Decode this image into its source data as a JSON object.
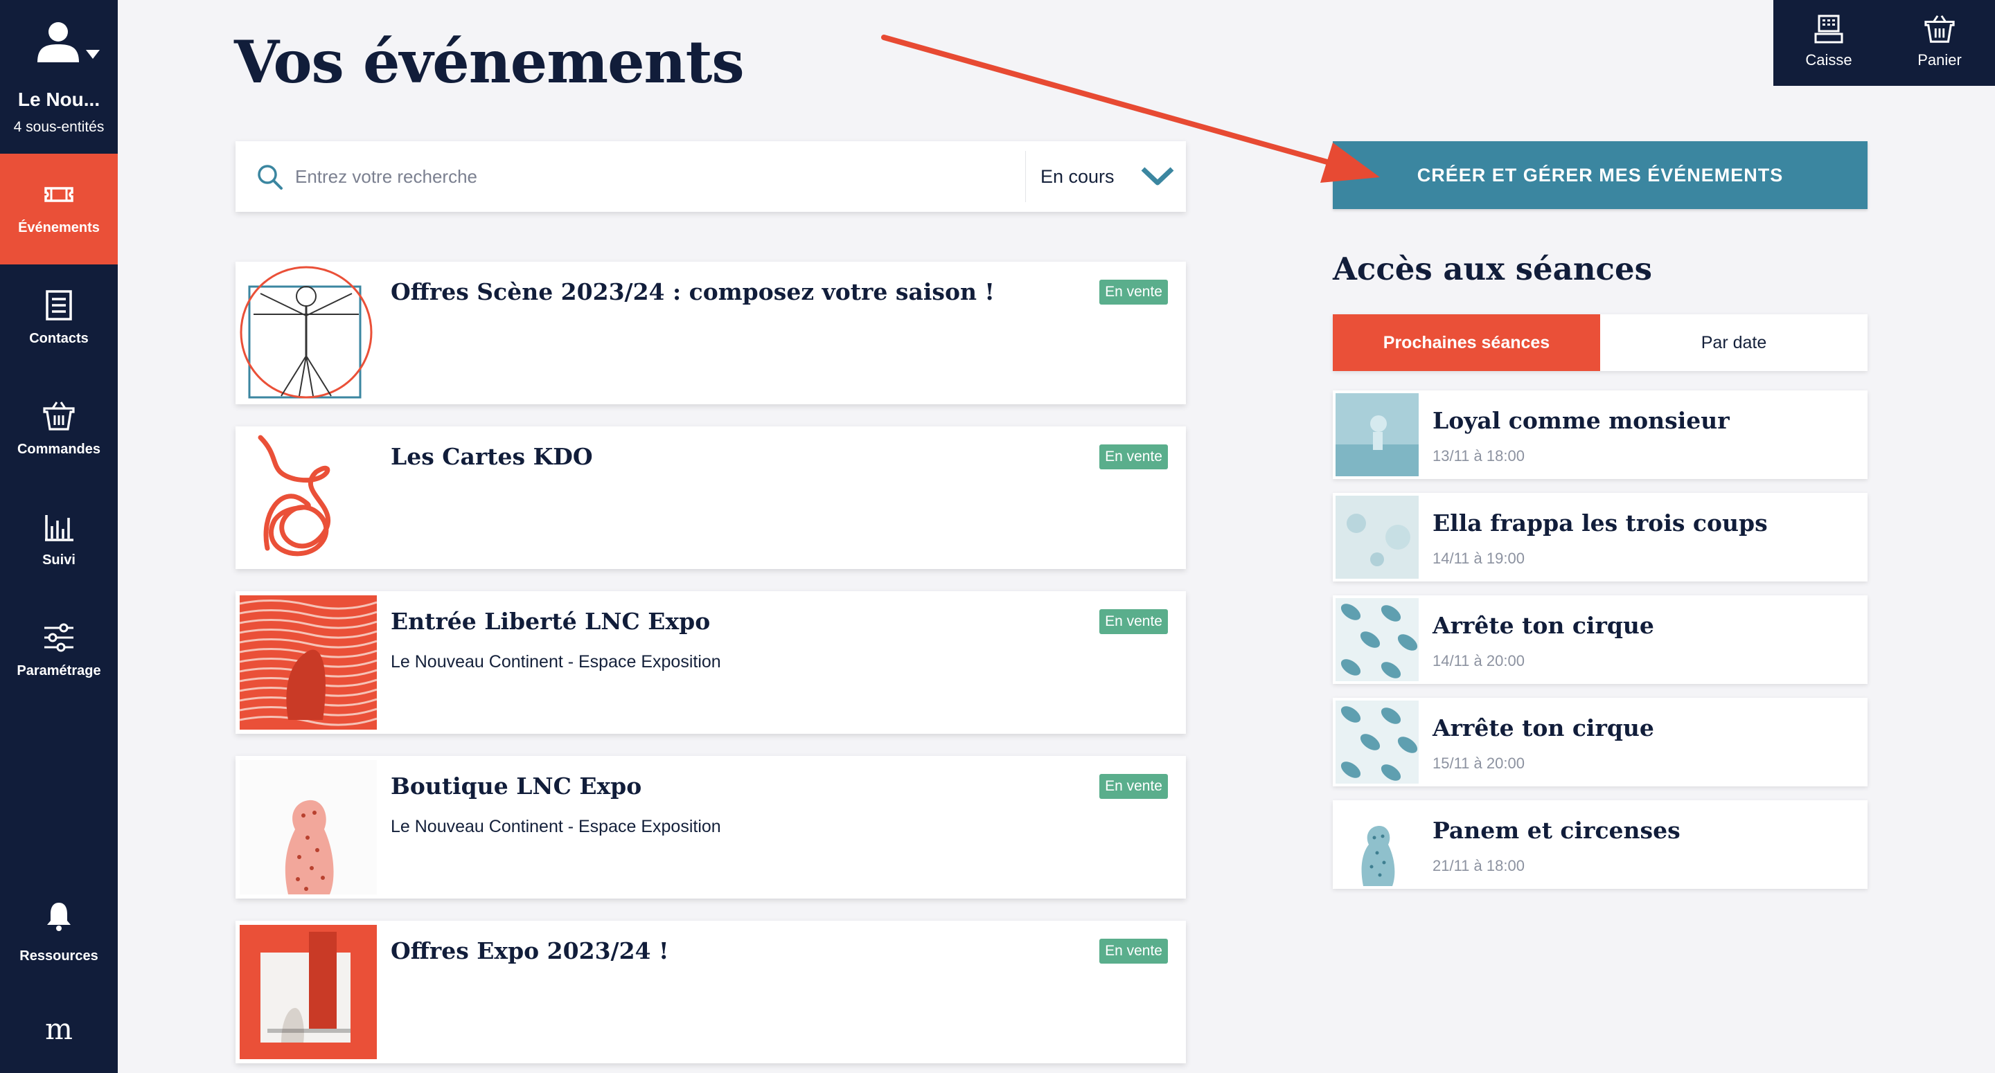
{
  "sidebar": {
    "user_name": "Le Nou...",
    "user_sub": "4 sous-entités",
    "items": [
      {
        "label": "Événements",
        "icon": "ticket-icon",
        "active": true
      },
      {
        "label": "Contacts",
        "icon": "contacts-icon"
      },
      {
        "label": "Commandes",
        "icon": "basket-icon"
      },
      {
        "label": "Suivi",
        "icon": "chart-bars-icon"
      },
      {
        "label": "Paramétrage",
        "icon": "sliders-icon"
      },
      {
        "label": "Ressources",
        "icon": "bell-icon"
      }
    ],
    "logo": "m"
  },
  "page": {
    "title": "Vos événements"
  },
  "topbar": {
    "caisse": "Caisse",
    "panier": "Panier"
  },
  "search": {
    "placeholder": "Entrez votre recherche",
    "filter_value": "En cours"
  },
  "events": [
    {
      "title": "Offres Scène 2023/24 : composez votre saison !",
      "subtitle": "",
      "badge": "En vente"
    },
    {
      "title": "Les Cartes KDO",
      "subtitle": "",
      "badge": "En vente"
    },
    {
      "title": "Entrée Liberté LNC Expo",
      "subtitle": "Le Nouveau Continent - Espace Exposition",
      "badge": "En vente"
    },
    {
      "title": "Boutique LNC Expo",
      "subtitle": "Le Nouveau Continent - Espace Exposition",
      "badge": "En vente"
    },
    {
      "title": "Offres Expo 2023/24 !",
      "subtitle": "",
      "badge": "En vente"
    }
  ],
  "right": {
    "cta": "CRÉER ET GÉRER MES ÉVÉNEMENTS",
    "section_title": "Accès aux séances",
    "tabs": [
      "Prochaines séances",
      "Par date"
    ],
    "sessions": [
      {
        "title": "Loyal comme monsieur",
        "date": "13/11 à 18:00"
      },
      {
        "title": "Ella frappa les trois coups",
        "date": "14/11 à 19:00"
      },
      {
        "title": "Arrête ton cirque",
        "date": "14/11 à 20:00"
      },
      {
        "title": "Arrête ton cirque",
        "date": "15/11 à 20:00"
      },
      {
        "title": "Panem et circenses",
        "date": "21/11 à 18:00"
      }
    ]
  },
  "colors": {
    "navy": "#111d3a",
    "accent": "#ea5038",
    "teal": "#3b86a0",
    "badge": "#5aae8c"
  }
}
